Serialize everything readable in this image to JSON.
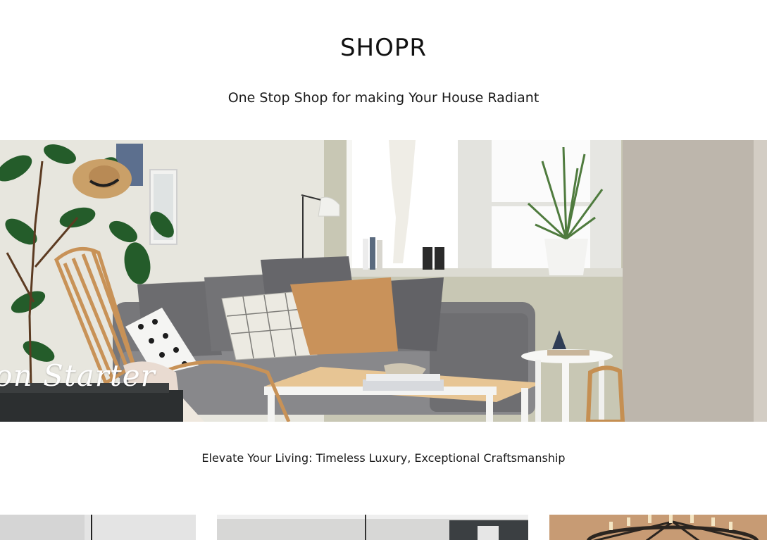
{
  "header": {
    "brand": "SHOPR",
    "tagline": "One Stop Shop for making Your House Radiant"
  },
  "hero": {
    "caption": "ion Starter"
  },
  "section": {
    "subtitle": "Elevate Your Living: Timeless Luxury, Exceptional Craftsmanship"
  },
  "colors": {
    "background": "#ffffff",
    "text": "#1a1a1a",
    "sofa": "#7d7d7f",
    "wall": "#e8e6dd",
    "accent_pillow": "#c9925a"
  }
}
